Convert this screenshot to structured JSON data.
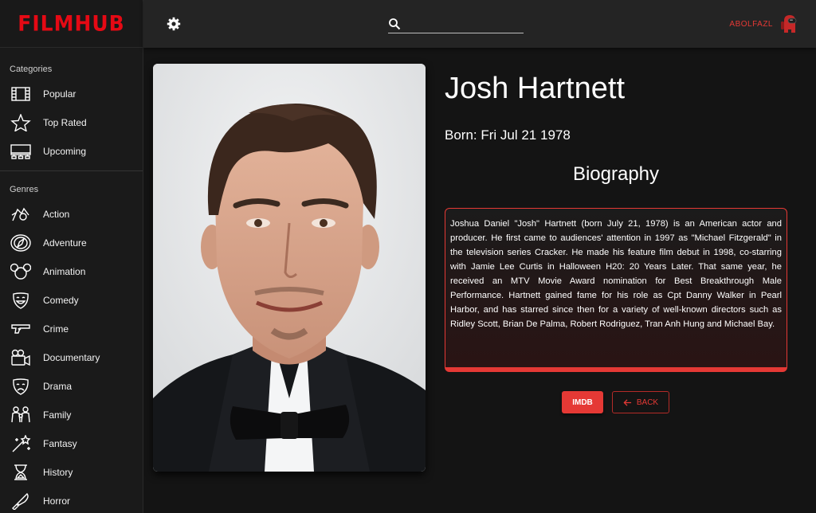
{
  "app": {
    "logo": "FILMHUB"
  },
  "sidebar": {
    "categories_title": "Categories",
    "categories": [
      {
        "label": "Popular",
        "icon": "film-strip-icon"
      },
      {
        "label": "Top Rated",
        "icon": "star-icon"
      },
      {
        "label": "Upcoming",
        "icon": "monitor-icon"
      }
    ],
    "genres_title": "Genres",
    "genres": [
      {
        "label": "Action",
        "icon": "action-icon"
      },
      {
        "label": "Adventure",
        "icon": "compass-icon"
      },
      {
        "label": "Animation",
        "icon": "mouse-ears-icon"
      },
      {
        "label": "Comedy",
        "icon": "comedy-mask-icon"
      },
      {
        "label": "Crime",
        "icon": "gun-icon"
      },
      {
        "label": "Documentary",
        "icon": "camera-icon"
      },
      {
        "label": "Drama",
        "icon": "drama-mask-icon"
      },
      {
        "label": "Family",
        "icon": "family-icon"
      },
      {
        "label": "Fantasy",
        "icon": "magic-wand-icon"
      },
      {
        "label": "History",
        "icon": "hourglass-icon"
      },
      {
        "label": "Horror",
        "icon": "knife-icon"
      }
    ]
  },
  "header": {
    "search_placeholder": "",
    "username": "ABOLFAZL"
  },
  "person": {
    "name": "Josh Hartnett",
    "born": "Born: Fri Jul 21 1978",
    "biography_heading": "Biography",
    "biography": "Joshua Daniel \"Josh\" Hartnett (born July 21, 1978) is an American actor and producer. He first came to audiences' attention in 1997 as \"Michael Fitzgerald\" in the television series Cracker. He made his feature film debut in 1998, co-starring with Jamie Lee Curtis in Halloween H20: 20 Years Later. That same year, he received an MTV Movie Award nomination for Best Breakthrough Male Performance. Hartnett gained fame for his role as Cpt Danny Walker in Pearl Harbor, and has starred since then for a variety of well-known directors such as Ridley Scott, Brian De Palma, Robert Rodriguez, Tran Anh Hung and Michael Bay."
  },
  "actions": {
    "imdb_label": "IMDB",
    "back_label": "BACK"
  },
  "colors": {
    "accent": "#e53935",
    "logo": "#e50914",
    "background": "#141414",
    "sidebar": "#1a1a1a",
    "header": "#242424"
  }
}
